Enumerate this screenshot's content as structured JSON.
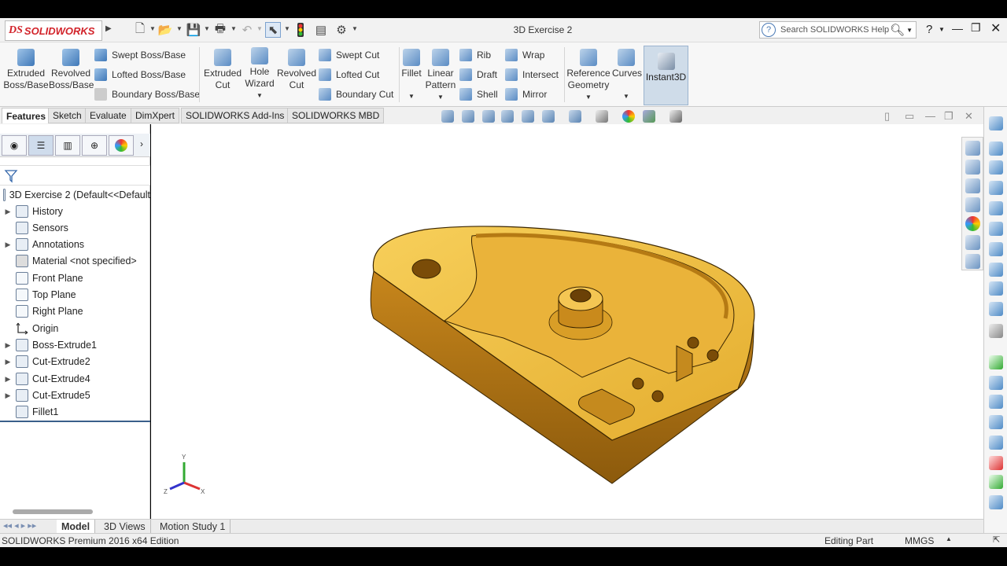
{
  "app": {
    "logo_prefix": "DS",
    "logo_name": "SOLIDWORKS",
    "document_title": "3D Exercise 2"
  },
  "help": {
    "search_placeholder": "Search SOLIDWORKS Help",
    "help_label": "?"
  },
  "ribbon": {
    "extruded_boss": "Extruded Boss/Base",
    "revolved_boss": "Revolved Boss/Base",
    "swept_boss": "Swept Boss/Base",
    "lofted_boss": "Lofted Boss/Base",
    "boundary_boss": "Boundary Boss/Base",
    "extruded_cut": "Extruded Cut",
    "hole_wizard": "Hole Wizard",
    "revolved_cut": "Revolved Cut",
    "swept_cut": "Swept Cut",
    "lofted_cut": "Lofted Cut",
    "boundary_cut": "Boundary Cut",
    "fillet": "Fillet",
    "linear_pattern": "Linear Pattern",
    "rib": "Rib",
    "draft": "Draft",
    "shell": "Shell",
    "wrap": "Wrap",
    "intersect": "Intersect",
    "mirror": "Mirror",
    "reference_geometry": "Reference Geometry",
    "curves": "Curves",
    "instant3d": "Instant3D"
  },
  "command_tabs": [
    "Features",
    "Sketch",
    "Evaluate",
    "DimXpert",
    "SOLIDWORKS Add-Ins",
    "SOLIDWORKS MBD"
  ],
  "tree": {
    "root": "3D Exercise 2  (Default<<Default",
    "items": [
      "History",
      "Sensors",
      "Annotations",
      "Material <not specified>",
      "Front Plane",
      "Top Plane",
      "Right Plane",
      "Origin",
      "Boss-Extrude1",
      "Cut-Extrude2",
      "Cut-Extrude4",
      "Cut-Extrude5",
      "Fillet1"
    ]
  },
  "triad": {
    "x": "X",
    "y": "Y",
    "z": "Z"
  },
  "bottom_tabs": [
    "Model",
    "3D Views",
    "Motion Study 1"
  ],
  "status": {
    "edition": "SOLIDWORKS Premium 2016 x64 Edition",
    "mode": "Editing Part",
    "units": "MMGS"
  },
  "colors": {
    "part_gold": "#e8b33a",
    "part_dark": "#a86c10",
    "accent_blue": "#3f78b8"
  }
}
